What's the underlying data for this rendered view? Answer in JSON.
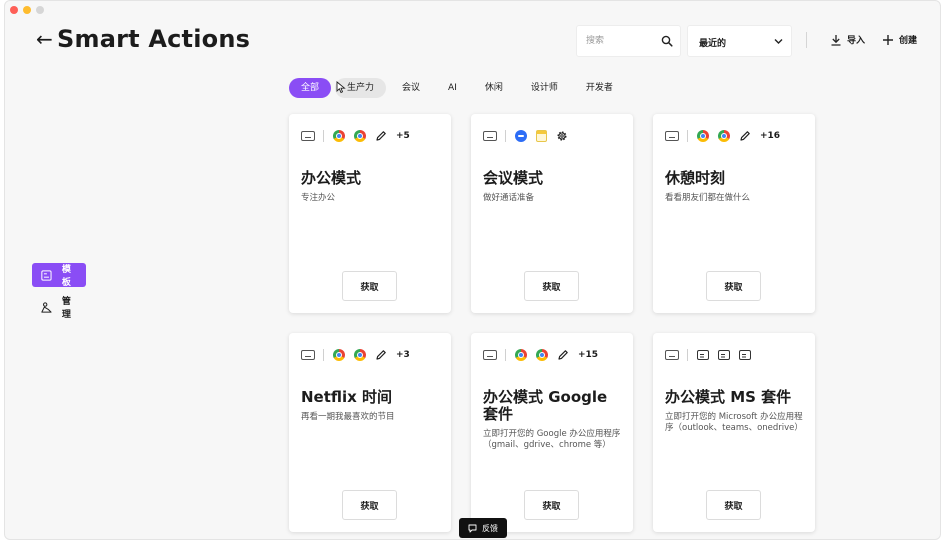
{
  "header": {
    "back_icon": "arrow-left-icon",
    "title": "Smart Actions",
    "search_placeholder": "搜索",
    "sort_label": "最近的",
    "import_label": "导入",
    "create_label": "创建"
  },
  "filters": [
    {
      "label": "全部",
      "active": true
    },
    {
      "label": "生产力",
      "active": false
    },
    {
      "label": "会议",
      "active": false
    },
    {
      "label": "AI",
      "active": false
    },
    {
      "label": "休闲",
      "active": false
    },
    {
      "label": "设计师",
      "active": false
    },
    {
      "label": "开发者",
      "active": false
    }
  ],
  "sidebar": {
    "items": [
      {
        "label": "模板",
        "icon": "template-icon",
        "active": true
      },
      {
        "label": "管理",
        "icon": "manage-icon",
        "active": false
      }
    ]
  },
  "cards": [
    {
      "title": "办公模式",
      "desc": "专注办公",
      "icons": [
        "keyboard-icon",
        "chrome-icon",
        "chrome-icon",
        "pencil-icon"
      ],
      "more": "+5",
      "button": "获取"
    },
    {
      "title": "会议模式",
      "desc": "做好通话准备",
      "icons": [
        "keyboard-icon",
        "zoom-icon",
        "notes-icon",
        "gear-icon"
      ],
      "more": "",
      "button": "获取"
    },
    {
      "title": "休憩时刻",
      "desc": "看看朋友们都在做什么",
      "icons": [
        "keyboard-icon",
        "chrome-icon",
        "chrome-icon",
        "pencil-icon"
      ],
      "more": "+16",
      "button": "获取"
    },
    {
      "title": "Netflix 时间",
      "desc": "再看一期我最喜欢的节目",
      "icons": [
        "keyboard-icon",
        "chrome-icon",
        "chrome-icon",
        "pencil-icon"
      ],
      "more": "+3",
      "button": "获取"
    },
    {
      "title": "办公模式 Google 套件",
      "desc": "立即打开您的 Google 办公应用程序（gmail、gdrive、chrome 等）",
      "icons": [
        "keyboard-icon",
        "chrome-icon",
        "chrome-icon",
        "pencil-icon"
      ],
      "more": "+15",
      "button": "获取"
    },
    {
      "title": "办公模式 MS 套件",
      "desc": "立即打开您的 Microsoft 办公应用程序（outlook、teams、onedrive）",
      "icons": [
        "keyboard-icon",
        "window-icon",
        "window-icon",
        "window-icon"
      ],
      "more": "",
      "button": "获取"
    }
  ],
  "feedback_label": "反馈",
  "colors": {
    "accent": "#8a4df5",
    "background": "#f7f7f7",
    "card": "#ffffff"
  }
}
